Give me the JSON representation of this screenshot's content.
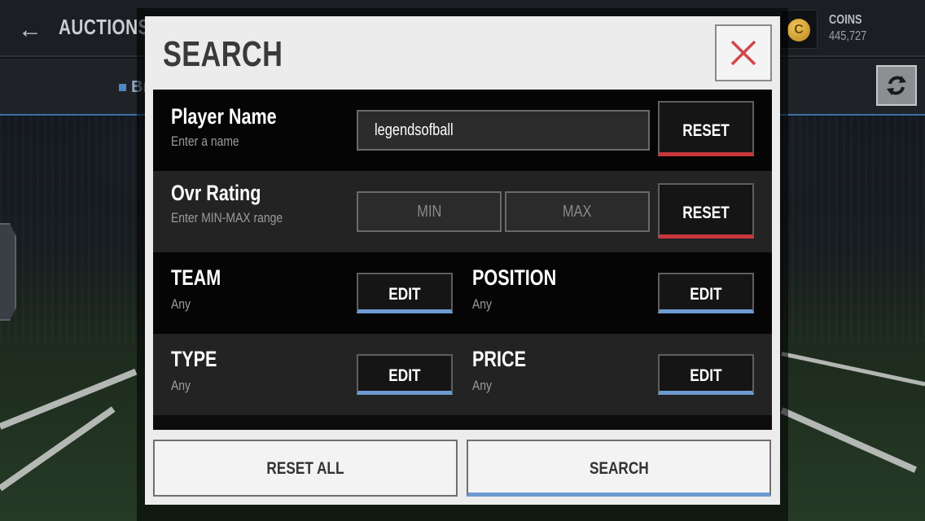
{
  "topbar": {
    "title": "AUCTIONS",
    "back_icon": "back-arrow-icon",
    "coins_label": "COINS",
    "coins_value": "445,727",
    "coin_icon": "coin-icon",
    "coin_glyph": "C"
  },
  "subbar": {
    "tab_label": "Br"
  },
  "modal": {
    "title": "SEARCH",
    "close_icon": "close-icon",
    "rows": {
      "player_name": {
        "label": "Player Name",
        "sublabel": "Enter a name",
        "value": "legendsofball",
        "reset_label": "RESET"
      },
      "ovr_rating": {
        "label": "Ovr Rating",
        "sublabel": "Enter MIN-MAX range",
        "min_placeholder": "MIN",
        "max_placeholder": "MAX",
        "reset_label": "RESET"
      },
      "team": {
        "label": "TEAM",
        "value": "Any",
        "edit_label": "EDIT"
      },
      "position": {
        "label": "POSITION",
        "value": "Any",
        "edit_label": "EDIT"
      },
      "type": {
        "label": "TYPE",
        "value": "Any",
        "edit_label": "EDIT"
      },
      "price": {
        "label": "PRICE",
        "value": "Any",
        "edit_label": "EDIT"
      }
    },
    "footer": {
      "reset_all_label": "RESET ALL",
      "search_label": "SEARCH"
    }
  },
  "colors": {
    "reset_accent": "#c8373b",
    "edit_accent": "#6d9bd1",
    "close_x": "#d0484c",
    "coin": "#e0ad3a"
  }
}
